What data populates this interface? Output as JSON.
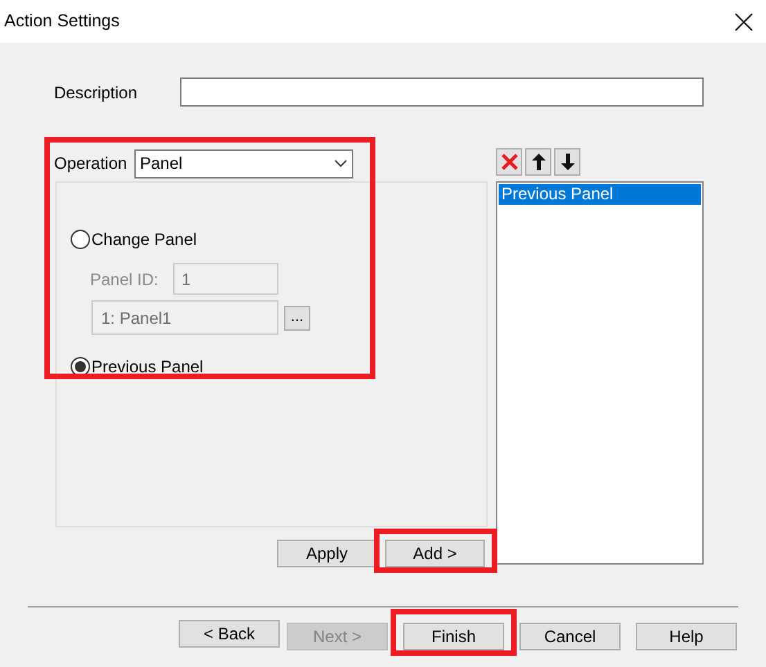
{
  "window": {
    "title": "Action Settings"
  },
  "description": {
    "label": "Description"
  },
  "operation": {
    "label": "Operation",
    "value": "Panel",
    "highlighted": true
  },
  "options": [
    {
      "label": "Change Panel",
      "selected": false
    },
    {
      "label": "Previous Panel",
      "selected": true
    }
  ],
  "panel_id": {
    "label": "Panel ID:",
    "value": "1",
    "disabled": true
  },
  "panel_select": {
    "value": "1: Panel1",
    "browse": "...",
    "disabled": true
  },
  "list": {
    "items": [
      {
        "label": "Previous Panel",
        "selected": true
      }
    ]
  },
  "actions": [
    {
      "label": "Apply",
      "highlighted": false
    },
    {
      "label": "Add >",
      "highlighted": true
    }
  ],
  "footer_buttons": [
    {
      "label": "< Back",
      "disabled": false,
      "highlighted": false
    },
    {
      "label": "Next >",
      "disabled": true,
      "highlighted": false
    },
    {
      "label": "Finish",
      "disabled": false,
      "highlighted": true
    },
    {
      "label": "Cancel",
      "disabled": false,
      "highlighted": false
    },
    {
      "label": "Help",
      "disabled": false,
      "highlighted": false
    }
  ]
}
